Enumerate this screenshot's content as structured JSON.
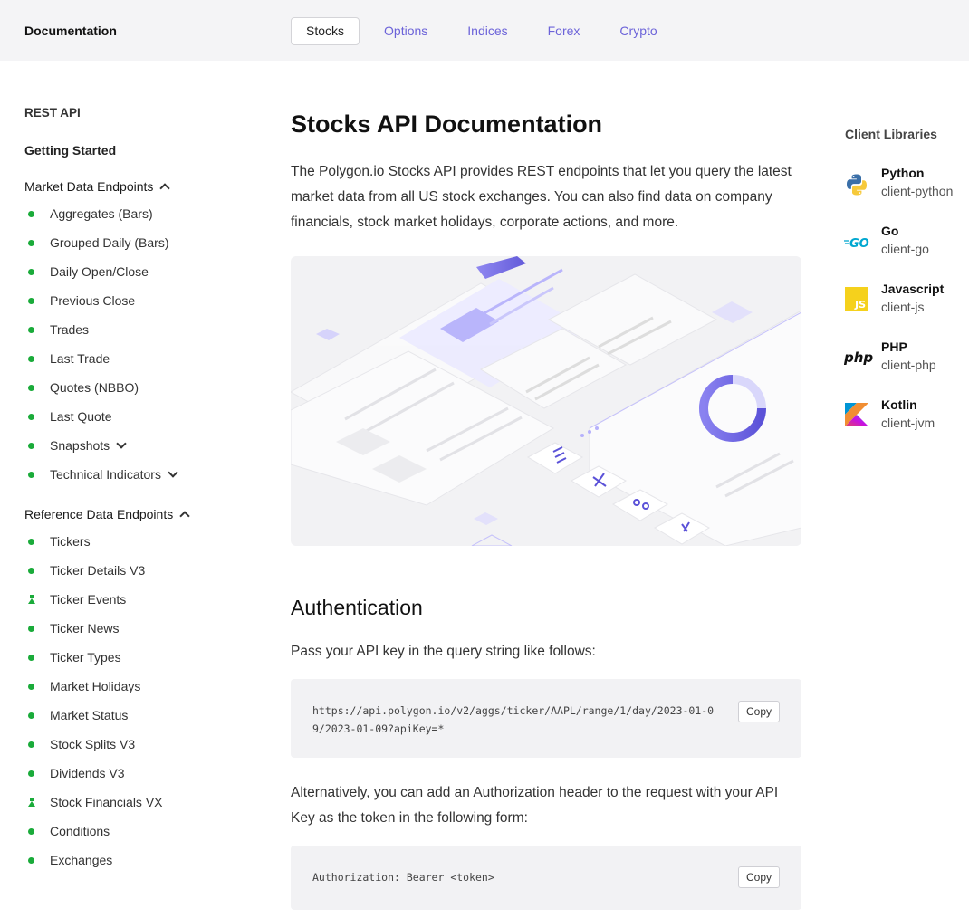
{
  "header": {
    "brand": "Documentation",
    "tabs": [
      {
        "label": "Stocks",
        "active": true
      },
      {
        "label": "Options",
        "active": false
      },
      {
        "label": "Indices",
        "active": false
      },
      {
        "label": "Forex",
        "active": false
      },
      {
        "label": "Crypto",
        "active": false
      }
    ]
  },
  "sidebar": {
    "rest_api": "REST API",
    "getting_started": "Getting Started",
    "market_data": {
      "title": "Market Data Endpoints",
      "items": [
        {
          "label": "Aggregates (Bars)",
          "icon": "dot"
        },
        {
          "label": "Grouped Daily (Bars)",
          "icon": "dot"
        },
        {
          "label": "Daily Open/Close",
          "icon": "dot"
        },
        {
          "label": "Previous Close",
          "icon": "dot"
        },
        {
          "label": "Trades",
          "icon": "dot"
        },
        {
          "label": "Last Trade",
          "icon": "dot"
        },
        {
          "label": "Quotes (NBBO)",
          "icon": "dot"
        },
        {
          "label": "Last Quote",
          "icon": "dot"
        },
        {
          "label": "Snapshots",
          "icon": "dot",
          "expandable": true
        },
        {
          "label": "Technical Indicators",
          "icon": "dot",
          "expandable": true
        }
      ]
    },
    "reference_data": {
      "title": "Reference Data Endpoints",
      "items": [
        {
          "label": "Tickers",
          "icon": "dot"
        },
        {
          "label": "Ticker Details V3",
          "icon": "dot"
        },
        {
          "label": "Ticker Events",
          "icon": "flask"
        },
        {
          "label": "Ticker News",
          "icon": "dot"
        },
        {
          "label": "Ticker Types",
          "icon": "dot"
        },
        {
          "label": "Market Holidays",
          "icon": "dot"
        },
        {
          "label": "Market Status",
          "icon": "dot"
        },
        {
          "label": "Stock Splits V3",
          "icon": "dot"
        },
        {
          "label": "Dividends V3",
          "icon": "dot"
        },
        {
          "label": "Stock Financials VX",
          "icon": "flask"
        },
        {
          "label": "Conditions",
          "icon": "dot"
        },
        {
          "label": "Exchanges",
          "icon": "dot"
        }
      ]
    },
    "status_color": "#1aab3a"
  },
  "main": {
    "title": "Stocks API Documentation",
    "intro": "The Polygon.io Stocks API provides REST endpoints that let you query the latest market data from all US stock exchanges. You can also find data on company financials, stock market holidays, corporate actions, and more.",
    "auth_title": "Authentication",
    "auth_text": "Pass your API key in the query string like follows:",
    "code1": "https://api.polygon.io/v2/aggs/ticker/AAPL/range/1/day/2023-01-0\n9/2023-01-09?apiKey=*",
    "alt_text": "Alternatively, you can add an Authorization header to the request with your API Key as the token in the following form:",
    "code2": "Authorization: Bearer <token>",
    "copy_label": "Copy"
  },
  "client_libraries": {
    "title": "Client Libraries",
    "items": [
      {
        "name": "Python",
        "repo": "client-python",
        "icon": "python-icon"
      },
      {
        "name": "Go",
        "repo": "client-go",
        "icon": "go-icon"
      },
      {
        "name": "Javascript",
        "repo": "client-js",
        "icon": "js-icon"
      },
      {
        "name": "PHP",
        "repo": "client-php",
        "icon": "php-icon"
      },
      {
        "name": "Kotlin",
        "repo": "client-jvm",
        "icon": "kotlin-icon"
      }
    ]
  },
  "colors": {
    "accent": "#6c63d9",
    "topbar_bg": "#f4f4f6"
  }
}
